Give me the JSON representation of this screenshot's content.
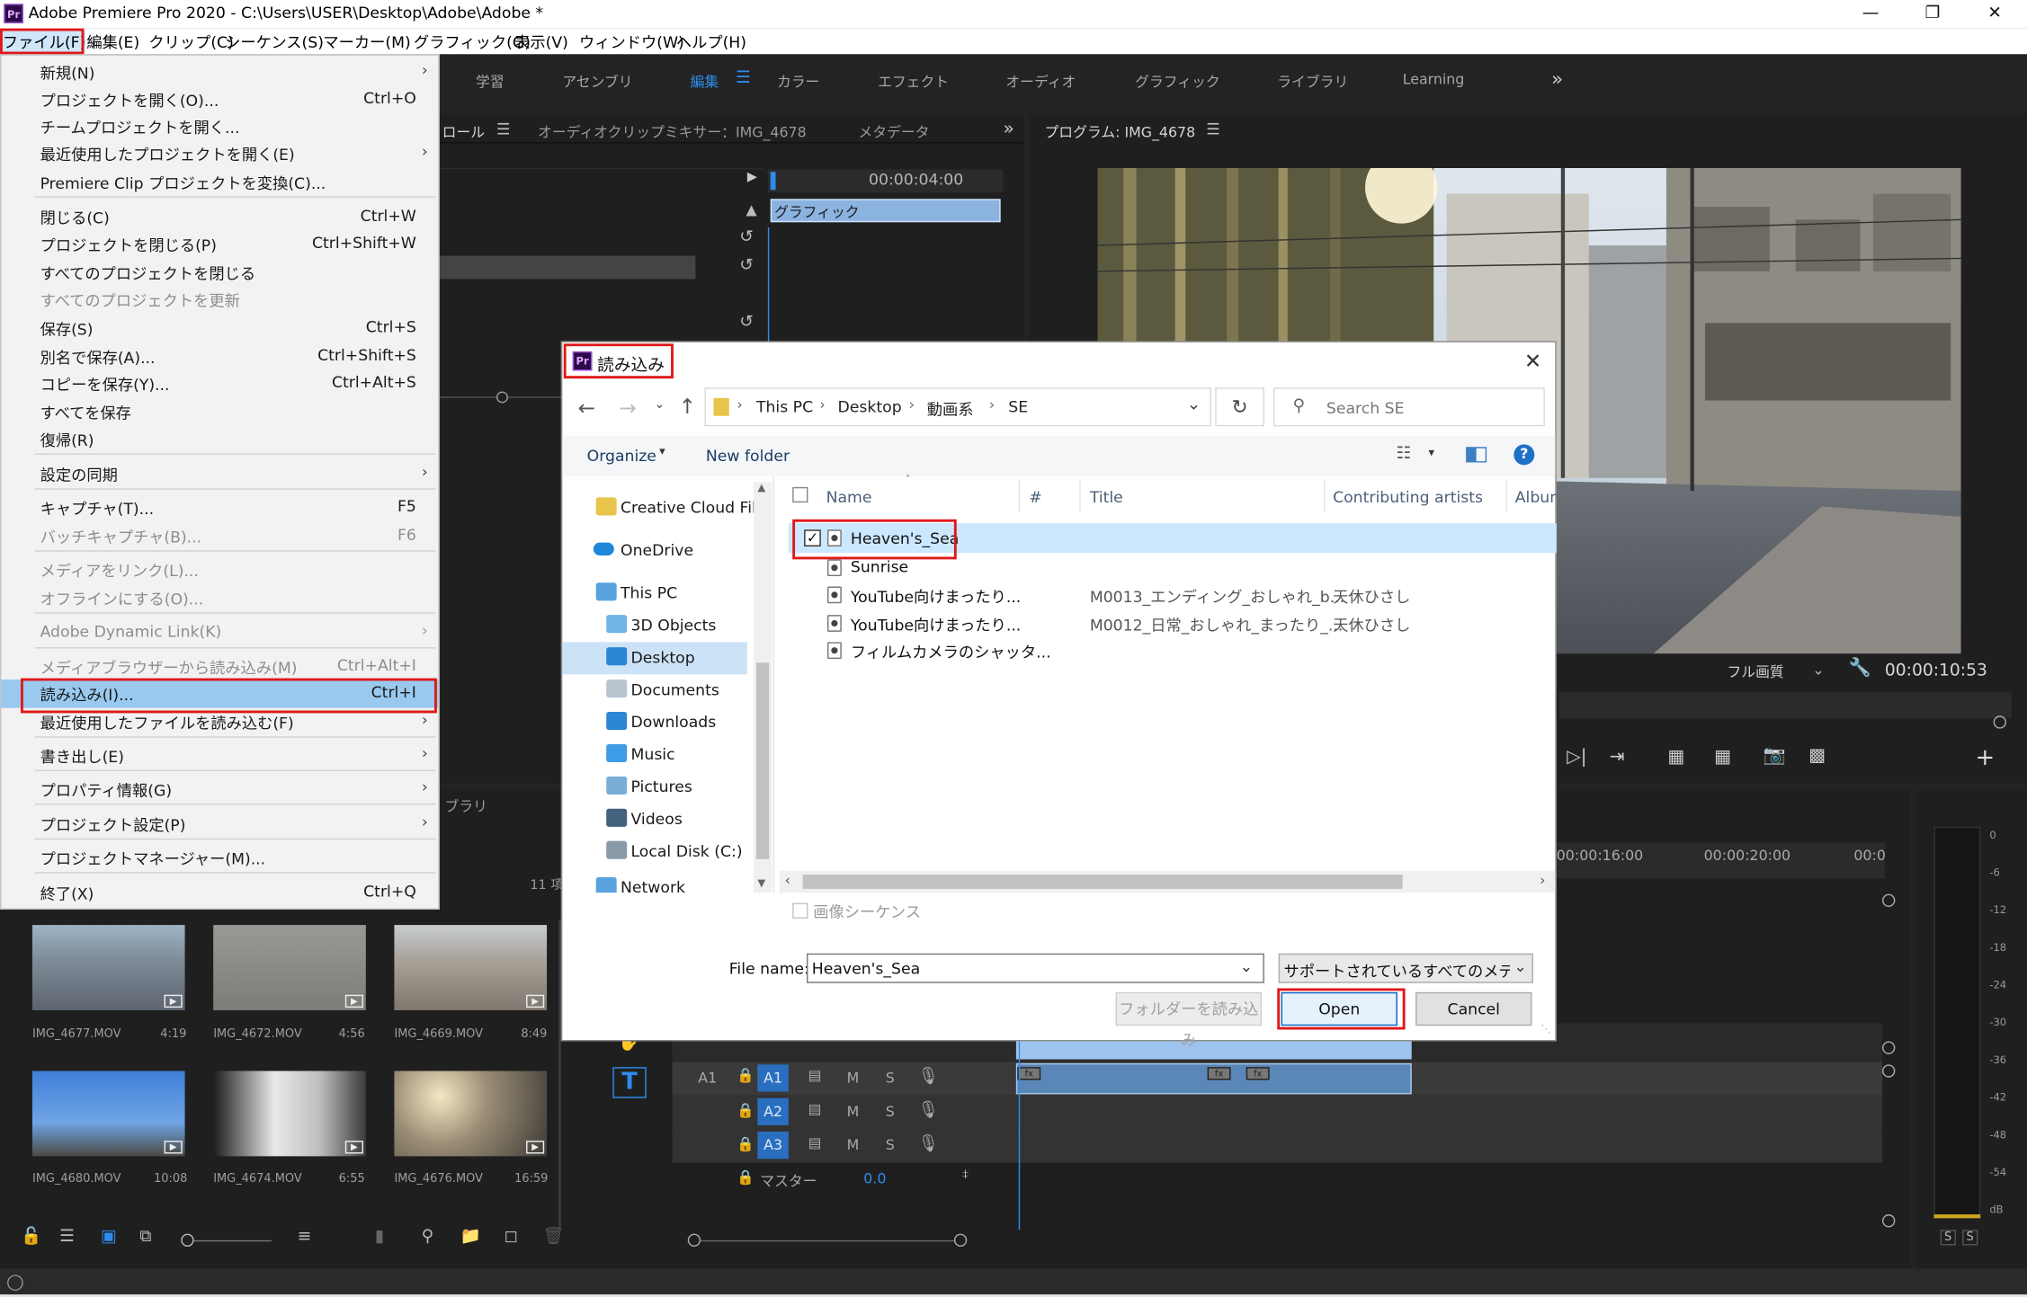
{
  "window": {
    "title": "Adobe Premiere Pro 2020 - C:\\Users\\USER\\Desktop\\Adobe\\Adobe *",
    "app_icon": "Pr"
  },
  "menubar": [
    "ファイル(F)",
    "編集(E)",
    "クリップ(C)",
    "シーケンス(S)",
    "マーカー(M)",
    "グラフィック(G)",
    "表示(V)",
    "ウィンドウ(W)",
    "ヘルプ(H)"
  ],
  "workspaces": [
    "学習",
    "アセンブリ",
    "編集",
    "カラー",
    "エフェクト",
    "オーディオ",
    "グラフィック",
    "ライブラリ",
    "Learning"
  ],
  "workspace_more": "»",
  "source_panel": {
    "tab1": "ロール",
    "tab2": "オーディオクリップミキサー：IMG_4678",
    "tab3": "メタデータ",
    "timecode": "00:00:04:00",
    "clip_label": "グラフィック"
  },
  "program_panel": {
    "title": "プログラム: IMG_4678",
    "quality": "フル画質",
    "timecode": "00:00:10:53"
  },
  "project_panel": {
    "tab": "ブラリ",
    "items_label": "11 項",
    "thumbs": [
      {
        "name": "IMG_4677.MOV",
        "dur": "4:19"
      },
      {
        "name": "IMG_4672.MOV",
        "dur": "4:56"
      },
      {
        "name": "IMG_4669.MOV",
        "dur": "8:49"
      },
      {
        "name": "IMG_4680.MOV",
        "dur": "10:08"
      },
      {
        "name": "IMG_4674.MOV",
        "dur": "6:55"
      },
      {
        "name": "IMG_4676.MOV",
        "dur": "16:59"
      }
    ]
  },
  "timeline": {
    "ruler": [
      "00:00:16:00",
      "00:00:20:00",
      "00:0"
    ],
    "tracks": [
      {
        "label": "A1",
        "btn": "A1"
      },
      {
        "btn": "A2"
      },
      {
        "btn": "A3"
      }
    ],
    "master_label": "マスター",
    "master_value": "0.0",
    "track_letters": {
      "m": "M",
      "s": "S"
    }
  },
  "meter": {
    "scale": [
      "0",
      "-6",
      "-12",
      "-18",
      "-24",
      "-30",
      "-36",
      "-42",
      "-48",
      "-54",
      "dB"
    ],
    "solo": [
      "S",
      "S"
    ]
  },
  "file_menu": {
    "items": [
      {
        "label": "新規(N)",
        "shortcut": "",
        "submenu": true,
        "disabled": false
      },
      {
        "label": "プロジェクトを開く(O)...",
        "shortcut": "Ctrl+O",
        "submenu": false,
        "disabled": false
      },
      {
        "label": "チームプロジェクトを開く...",
        "shortcut": "",
        "submenu": false,
        "disabled": false
      },
      {
        "label": "最近使用したプロジェクトを開く(E)",
        "shortcut": "",
        "submenu": true,
        "disabled": false
      },
      {
        "label": "Premiere Clip プロジェクトを変換(C)...",
        "shortcut": "",
        "submenu": false,
        "disabled": false
      },
      {
        "label": "閉じる(C)",
        "shortcut": "Ctrl+W",
        "submenu": false,
        "disabled": false
      },
      {
        "label": "プロジェクトを閉じる(P)",
        "shortcut": "Ctrl+Shift+W",
        "submenu": false,
        "disabled": false
      },
      {
        "label": "すべてのプロジェクトを閉じる",
        "shortcut": "",
        "submenu": false,
        "disabled": false
      },
      {
        "label": "すべてのプロジェクトを更新",
        "shortcut": "",
        "submenu": false,
        "disabled": true
      },
      {
        "label": "保存(S)",
        "shortcut": "Ctrl+S",
        "submenu": false,
        "disabled": false
      },
      {
        "label": "別名で保存(A)...",
        "shortcut": "Ctrl+Shift+S",
        "submenu": false,
        "disabled": false
      },
      {
        "label": "コピーを保存(Y)...",
        "shortcut": "Ctrl+Alt+S",
        "submenu": false,
        "disabled": false
      },
      {
        "label": "すべてを保存",
        "shortcut": "",
        "submenu": false,
        "disabled": false
      },
      {
        "label": "復帰(R)",
        "shortcut": "",
        "submenu": false,
        "disabled": false
      },
      {
        "label": "設定の同期",
        "shortcut": "",
        "submenu": true,
        "disabled": false
      },
      {
        "label": "キャプチャ(T)...",
        "shortcut": "F5",
        "submenu": false,
        "disabled": false
      },
      {
        "label": "バッチキャプチャ(B)...",
        "shortcut": "F6",
        "submenu": false,
        "disabled": true
      },
      {
        "label": "メディアをリンク(L)...",
        "shortcut": "",
        "submenu": false,
        "disabled": true
      },
      {
        "label": "オフラインにする(O)...",
        "shortcut": "",
        "submenu": false,
        "disabled": true
      },
      {
        "label": "Adobe Dynamic Link(K)",
        "shortcut": "",
        "submenu": true,
        "disabled": true
      },
      {
        "label": "メディアブラウザーから読み込み(M)",
        "shortcut": "Ctrl+Alt+I",
        "submenu": false,
        "disabled": true
      },
      {
        "label": "読み込み(I)...",
        "shortcut": "Ctrl+I",
        "submenu": false,
        "disabled": false
      },
      {
        "label": "最近使用したファイルを読み込む(F)",
        "shortcut": "",
        "submenu": true,
        "disabled": false
      },
      {
        "label": "書き出し(E)",
        "shortcut": "",
        "submenu": true,
        "disabled": false
      },
      {
        "label": "プロパティ情報(G)",
        "shortcut": "",
        "submenu": true,
        "disabled": false
      },
      {
        "label": "プロジェクト設定(P)",
        "shortcut": "",
        "submenu": true,
        "disabled": false
      },
      {
        "label": "プロジェクトマネージャー(M)...",
        "shortcut": "",
        "submenu": false,
        "disabled": false
      },
      {
        "label": "終了(X)",
        "shortcut": "Ctrl+Q",
        "submenu": false,
        "disabled": false
      }
    ]
  },
  "dialog": {
    "title": "読み込み",
    "breadcrumb": [
      "This PC",
      "Desktop",
      "動画系",
      "SE"
    ],
    "search_placeholder": "Search SE",
    "organize": "Organize",
    "new_folder": "New folder",
    "nav": [
      "Creative Cloud File",
      "OneDrive",
      "This PC",
      "3D Objects",
      "Desktop",
      "Documents",
      "Downloads",
      "Music",
      "Pictures",
      "Videos",
      "Local Disk (C:)",
      "Network"
    ],
    "columns": [
      "Name",
      "#",
      "Title",
      "Contributing artists",
      "Album"
    ],
    "files": [
      {
        "name": "Heaven's_Sea",
        "title": "",
        "artist": "",
        "checked": true
      },
      {
        "name": "Sunrise",
        "title": "",
        "artist": "",
        "checked": false
      },
      {
        "name": "YouTube向けまったり...",
        "title": "M0013_エンディング_おしゃれ_b...",
        "artist": "天休ひさし",
        "checked": false
      },
      {
        "name": "YouTube向けまったり...",
        "title": "M0012_日常_おしゃれ_まったり_...",
        "artist": "天休ひさし",
        "checked": false
      },
      {
        "name": "フィルムカメラのシャッタ...",
        "title": "",
        "artist": "",
        "checked": false
      }
    ],
    "image_sequence": "画像シーケンス",
    "filename_label": "File name:",
    "filename_value": "Heaven's_Sea",
    "filetype": "サポートされているすべてのメディア",
    "import_folder": "フォルダーを読み込み",
    "open": "Open",
    "cancel": "Cancel"
  },
  "colors": {
    "accent_red": "#e01818",
    "selection_blue": "#99c9ef",
    "premiere_blue": "#2d8ceb"
  }
}
